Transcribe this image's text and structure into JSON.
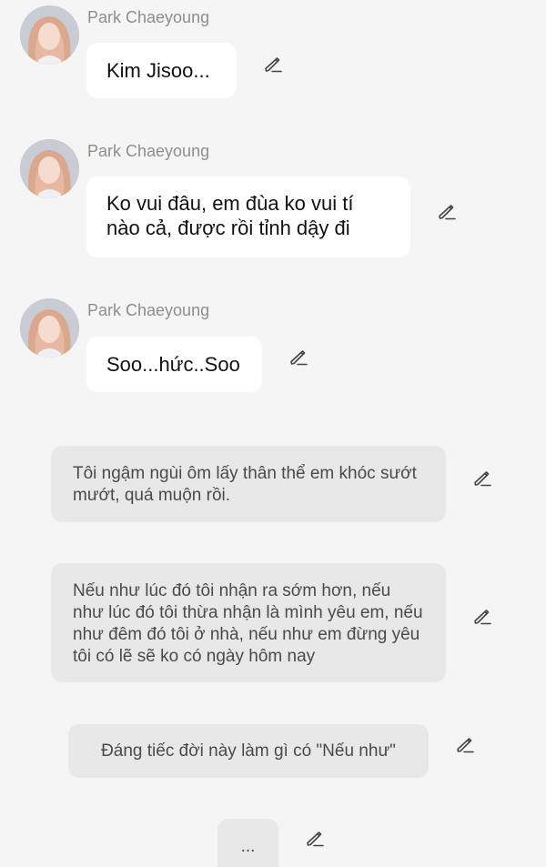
{
  "icons": {
    "avatar": "avatar-photo",
    "edit": "pencil-edit-icon"
  },
  "colors": {
    "background": "#f5f5f5",
    "character_bubble": "#ffffff",
    "narration_bubble": "#e8e8e8",
    "sender_name": "#8e8e8e"
  },
  "messages": [
    {
      "sender": "Park Chaeyoung",
      "text": "Kim Jisoo..."
    },
    {
      "sender": "Park Chaeyoung",
      "text": "Ko vui đâu, em đùa ko vui tí nào cả, được rồi tỉnh dậy đi"
    },
    {
      "sender": "Park Chaeyoung",
      "text": "Soo...hức..Soo"
    }
  ],
  "narrations": [
    {
      "text": "Tôi ngậm ngùi ôm lấy thân thể em khóc sướt mướt, quá muộn rồi."
    },
    {
      "text": "Nếu như lúc đó tôi nhận ra sớm hơn, nếu như lúc đó tôi thừa nhận là mình yêu em, nếu như đêm đó tôi ở nhà, nếu như em đừng yêu tôi có lẽ sẽ ko có ngày hôm nay"
    },
    {
      "text": "Đáng tiếc đời này làm gì có \"Nếu như\""
    },
    {
      "text": "..."
    }
  ]
}
